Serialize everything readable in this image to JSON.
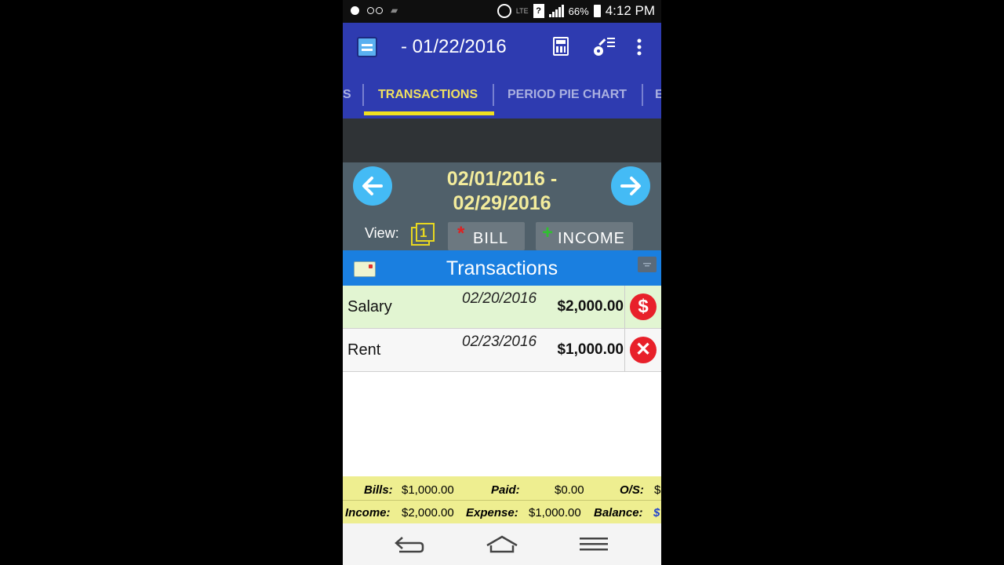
{
  "status_bar": {
    "battery": "66%",
    "time": "4:12 PM",
    "sim_icon": "?"
  },
  "app_bar": {
    "title": "- 01/22/2016",
    "icons": [
      "app-logo-icon",
      "calculator-icon",
      "key-menu-icon",
      "overflow-menu-icon"
    ]
  },
  "tabs": {
    "items": [
      {
        "label": "S",
        "active": false
      },
      {
        "label": "TRANSACTIONS",
        "active": true
      },
      {
        "label": "PERIOD PIE CHART",
        "active": false
      },
      {
        "label": "E",
        "active": false
      }
    ]
  },
  "period": {
    "range_line1": "02/01/2016 -",
    "range_line2": "02/29/2016",
    "view_label": "View:",
    "view_count": "1",
    "bill_button": "BILL",
    "income_button": "INCOME"
  },
  "transactions": {
    "header": "Transactions",
    "rows": [
      {
        "name": "Salary",
        "date": "02/20/2016",
        "amount": "$2,000.00",
        "status_icon": "dollar-icon",
        "highlight": "#e2f5d2"
      },
      {
        "name": "Rent",
        "date": "02/23/2016",
        "amount": "$1,000.00",
        "status_icon": "close-icon",
        "highlight": "#f7f7f7"
      }
    ]
  },
  "summary": {
    "bills_label": "Bills:",
    "bills_value": "$1,000.00",
    "paid_label": "Paid:",
    "paid_value": "$0.00",
    "os_label": "O/S:",
    "os_value": "$",
    "income_label": "Income:",
    "income_value": "$2,000.00",
    "expense_label": "Expense:",
    "expense_value": "$1,000.00",
    "balance_label": "Balance:",
    "balance_value": "$"
  },
  "colors": {
    "app_bar": "#2e3bb0",
    "tab_active": "#f0e060",
    "period_text": "#f3ec9c",
    "arrow": "#44bbf5",
    "transactions_header": "#1a7fe0",
    "summary_bg": "#eeee90"
  }
}
